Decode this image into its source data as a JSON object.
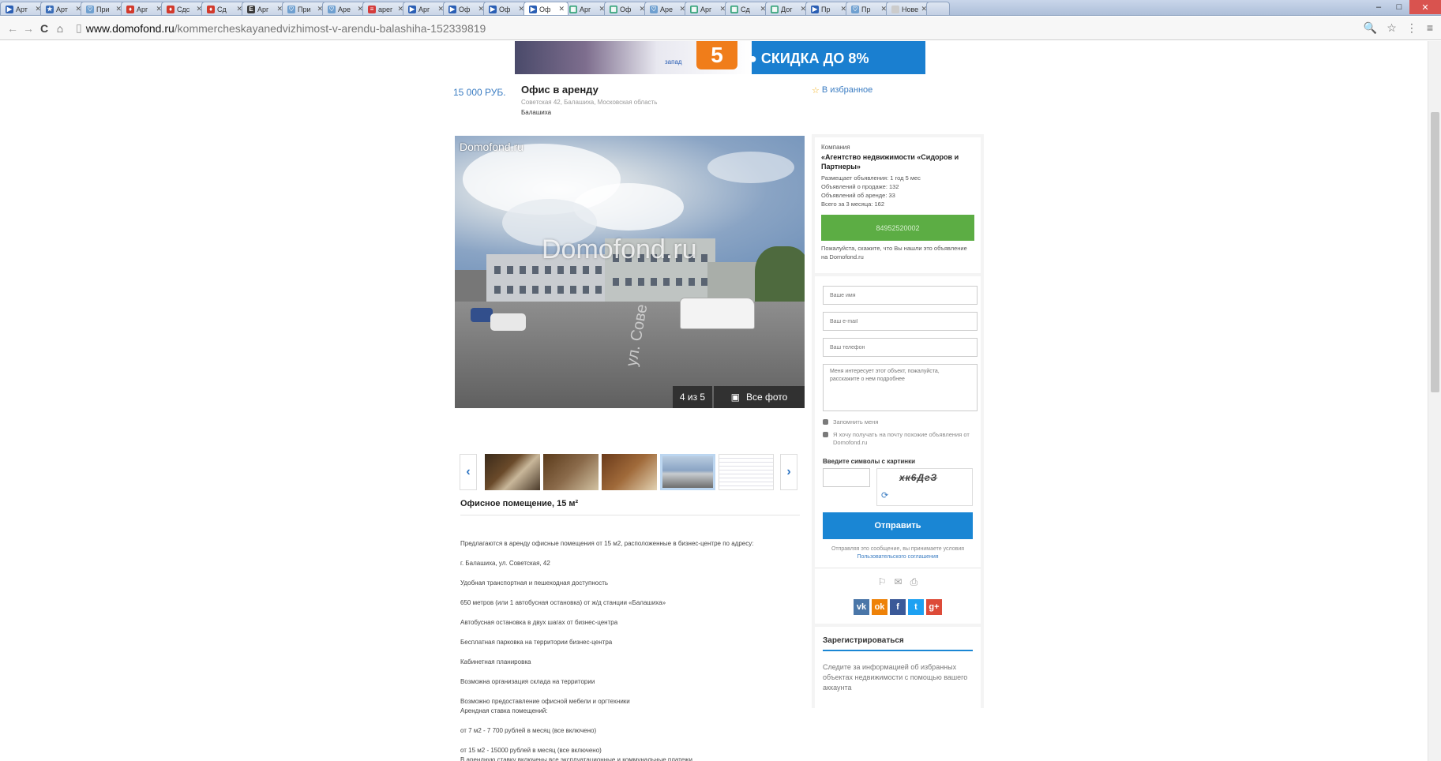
{
  "browser": {
    "tabs": [
      {
        "label": "Арт",
        "color": "#2b5fb4",
        "glyph": "▶"
      },
      {
        "label": "Арт",
        "color": "#3a6db8",
        "glyph": "★"
      },
      {
        "label": "При",
        "color": "#6fa0d0",
        "glyph": "♡"
      },
      {
        "label": "Арг",
        "color": "#d23a2c",
        "glyph": "♦"
      },
      {
        "label": "Сдс",
        "color": "#d23a2c",
        "glyph": "♦"
      },
      {
        "label": "Сд",
        "color": "#d23a2c",
        "glyph": "♦"
      },
      {
        "label": "Арг",
        "color": "#3b3b3b",
        "glyph": "Е"
      },
      {
        "label": "При",
        "color": "#6fa0d0",
        "glyph": "♡"
      },
      {
        "label": "Аре",
        "color": "#6fa0d0",
        "glyph": "♡"
      },
      {
        "label": "арег",
        "color": "#d43c3c",
        "glyph": "≡"
      },
      {
        "label": "Арг",
        "color": "#2b5fb4",
        "glyph": "▶"
      },
      {
        "label": "Оф",
        "color": "#2b5fb4",
        "glyph": "▶"
      },
      {
        "label": "Оф",
        "color": "#2b5fb4",
        "glyph": "▶"
      },
      {
        "label": "Оф",
        "color": "#2b5fb4",
        "glyph": "▶",
        "active": true
      },
      {
        "label": "Арг",
        "color": "#3aa57e",
        "glyph": "▦"
      },
      {
        "label": "Оф",
        "color": "#3aa57e",
        "glyph": "▦"
      },
      {
        "label": "Аре",
        "color": "#6fa0d0",
        "glyph": "♡"
      },
      {
        "label": "Арг",
        "color": "#3aa57e",
        "glyph": "▦"
      },
      {
        "label": "Сд",
        "color": "#3aa57e",
        "glyph": "▦"
      },
      {
        "label": "Дог",
        "color": "#3aa57e",
        "glyph": "▦"
      },
      {
        "label": "Пр",
        "color": "#2b5fb4",
        "glyph": "▶"
      },
      {
        "label": "Пр",
        "color": "#6fa0d0",
        "glyph": "♡"
      },
      {
        "label": "Нове",
        "color": "#cccccc",
        "glyph": " "
      }
    ],
    "url_host": "www.domofond.ru",
    "url_path": "/kommercheskayanedvizhimost-v-arendu-balashiha-152339819"
  },
  "banner": {
    "promo_text": "● СКИДКА ДО 8%",
    "side_text": "запад",
    "number": "5"
  },
  "listing": {
    "price": "15 000 РУБ.",
    "title": "Офис в аренду",
    "address": "Советская 42, Балашиха, Московская область",
    "city": "Балашиха",
    "favorite": "В избранное"
  },
  "photo": {
    "watermark_corner": "Domofond.ru",
    "watermark_center": "Domofond.ru",
    "street_sign": "ул. Сове",
    "counter": "4 из 5",
    "all_photos": "Все фото"
  },
  "description": {
    "heading": "Офисное помещение, 15 м²",
    "paragraphs": [
      "Предлагаются в аренду офисные помещения от 15 м2, расположенные в бизнес-центре по адресу:",
      "г. Балашиха, ул. Советская, 42",
      "Удобная транспортная и пешеходная доступность",
      "650 метров (или 1 автобусная остановка) от ж/д станции «Балашиха»",
      "Автобусная остановка в двух шагах от бизнес-центра",
      "Бесплатная парковка на территории бизнес-центра",
      "Кабинетная планировка",
      "Возможна организация склада на территории",
      "Возможно предоставление офисной мебели и оргтехники\nАрендная ставка помещений:",
      "от 7 м2 - 7 700 рублей в месяц (все включено)",
      "от 15 м2 - 15000 рублей в месяц (все включено)\nВ арендную ставку включены все эксплуатационные и коммунальные платежи"
    ]
  },
  "company": {
    "label": "Компания",
    "name": "«Агентство недвижимости «Сидоров и Партнеры»",
    "stats": [
      "Размещает объявления: 1 год 5 мес",
      "Объявлений о продаже: 132",
      "Объявлений об аренде: 33",
      "Всего за 3 месяца: 162"
    ],
    "phone": "84952520002",
    "note": "Пожалуйста, скажите, что Вы нашли это объявление на Domofond.ru"
  },
  "contact_form": {
    "name_placeholder": "Ваше имя",
    "email_placeholder": "Ваш e-mail",
    "phone_placeholder": "Ваш телефон",
    "message_placeholder": "Меня интересует этот объект, пожалуйста, расскажите о нем подробнее",
    "remember": "Запомнить меня",
    "subscribe": "Я хочу получать на почту похожие объявления от Domofond.ru",
    "captcha_label": "Введите символы с картинки",
    "captcha_text": "хк6ДгЗ",
    "send": "Отправить",
    "terms_prefix": "Отправляя это сообщение, вы принимаете условия",
    "terms_link": "Пользовательского соглашения"
  },
  "social": [
    {
      "label": "vk",
      "color": "#4a76a8"
    },
    {
      "label": "ok",
      "color": "#ee8208"
    },
    {
      "label": "f",
      "color": "#3b5998"
    },
    {
      "label": "t",
      "color": "#1da1f2"
    },
    {
      "label": "g+",
      "color": "#dd4b39"
    }
  ],
  "register": {
    "title": "Зарегистрироваться",
    "text": "Следите за информацией об избранных объектах недвижимости с помощью вашего аккаунта"
  }
}
